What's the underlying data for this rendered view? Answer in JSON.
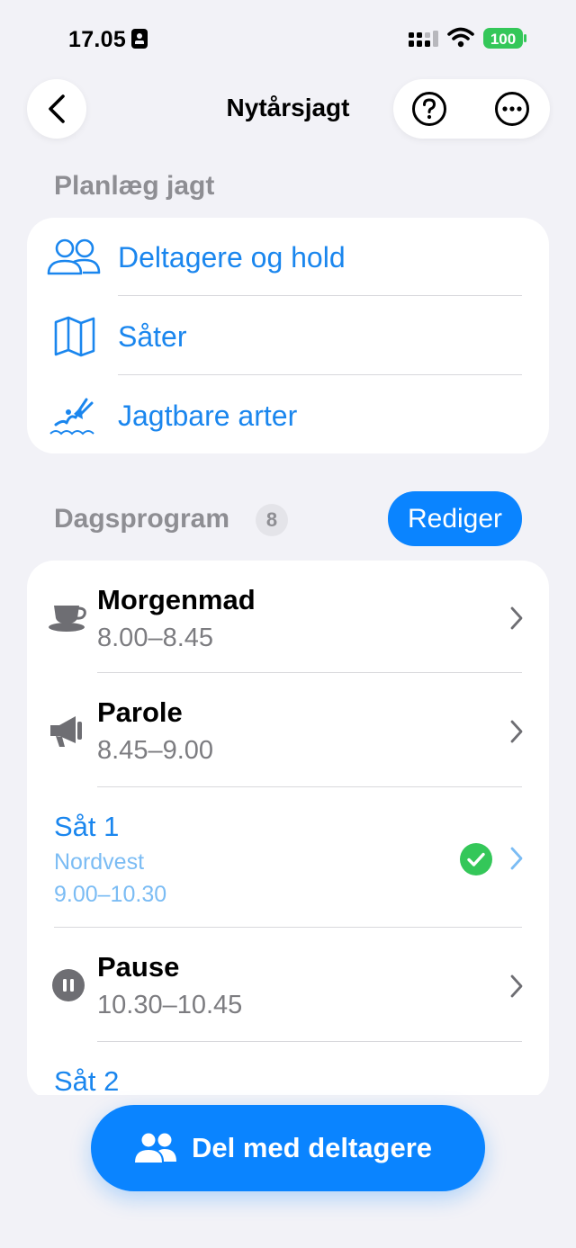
{
  "status_bar": {
    "time": "17.05",
    "battery": "100"
  },
  "nav": {
    "title": "Nytårsjagt"
  },
  "plan": {
    "title": "Planlæg jagt",
    "items": [
      {
        "label": "Deltagere og hold",
        "icon": "people-icon"
      },
      {
        "label": "Såter",
        "icon": "map-icon"
      },
      {
        "label": "Jagtbare arter",
        "icon": "game-species-icon"
      }
    ]
  },
  "program": {
    "title": "Dagsprogram",
    "count": "8",
    "edit_label": "Rediger",
    "items": [
      {
        "title": "Morgenmad",
        "time": "8.00–8.45",
        "icon": "coffee-cup-icon"
      },
      {
        "title": "Parole",
        "time": "8.45–9.00",
        "icon": "megaphone-icon"
      },
      {
        "title": "Såt 1",
        "subtitle": "Nordvest",
        "time": "9.00–10.30",
        "status": "completed"
      },
      {
        "title": "Pause",
        "time": "10.30–10.45",
        "icon": "pause-icon"
      },
      {
        "title": "Såt 2"
      }
    ]
  },
  "share": {
    "label": "Del med deltagere"
  },
  "colors": {
    "accent": "#0a84ff",
    "link": "#1a86ee",
    "success": "#34c759",
    "background": "#f2f2f7"
  }
}
